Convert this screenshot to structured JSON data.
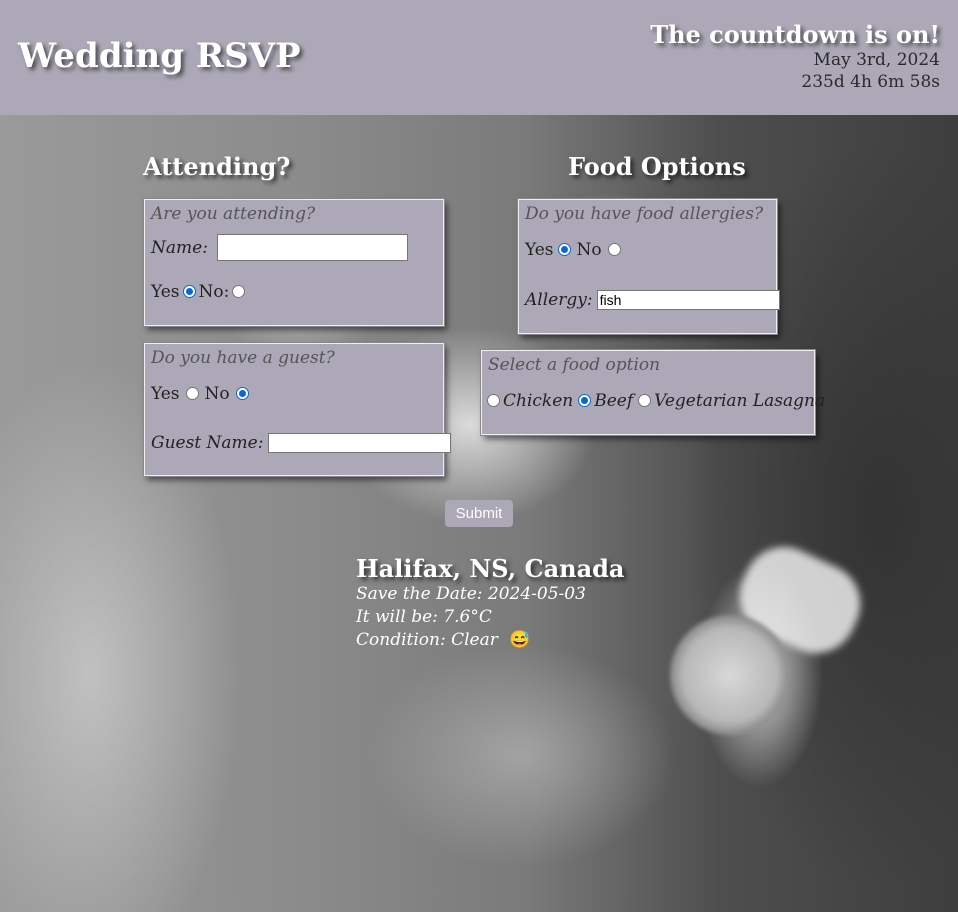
{
  "header": {
    "title": "Wedding RSVP",
    "countdown_title": "The countdown is on!",
    "date": "May 3rd, 2024",
    "timer": "235d 4h 6m 58s"
  },
  "attending_section": {
    "title": "Attending?",
    "attending_panel": {
      "legend": "Are you attending?",
      "name_label": "Name:",
      "name_value": "",
      "yes_label": "Yes",
      "no_label": "No:",
      "selected": "yes"
    },
    "guest_panel": {
      "legend": "Do you have a guest?",
      "yes_label": "Yes",
      "no_label": "No",
      "selected": "no",
      "guest_name_label": "Guest Name:",
      "guest_name_value": ""
    }
  },
  "food_section": {
    "title": "Food Options",
    "allergy_panel": {
      "legend": "Do you have food allergies?",
      "yes_label": "Yes",
      "no_label": "No",
      "selected": "yes",
      "allergy_label": "Allergy:",
      "allergy_value": "fish"
    },
    "food_panel": {
      "legend": "Select a food option",
      "options": [
        "Chicken",
        "Beef",
        "Vegetarian Lasagna"
      ],
      "selected": "Beef"
    }
  },
  "submit_label": "Submit",
  "weather": {
    "location": "Halifax, NS, Canada",
    "save_the_date": "Save the Date: 2024-05-03",
    "temperature": "It will be: 7.6°C",
    "condition": "Condition: Clear",
    "condition_emoji": "😅"
  },
  "colors": {
    "header_bg": "#aca8b7",
    "panel_bg": "#aca8b7",
    "radio_accent": "#0a66d8"
  }
}
